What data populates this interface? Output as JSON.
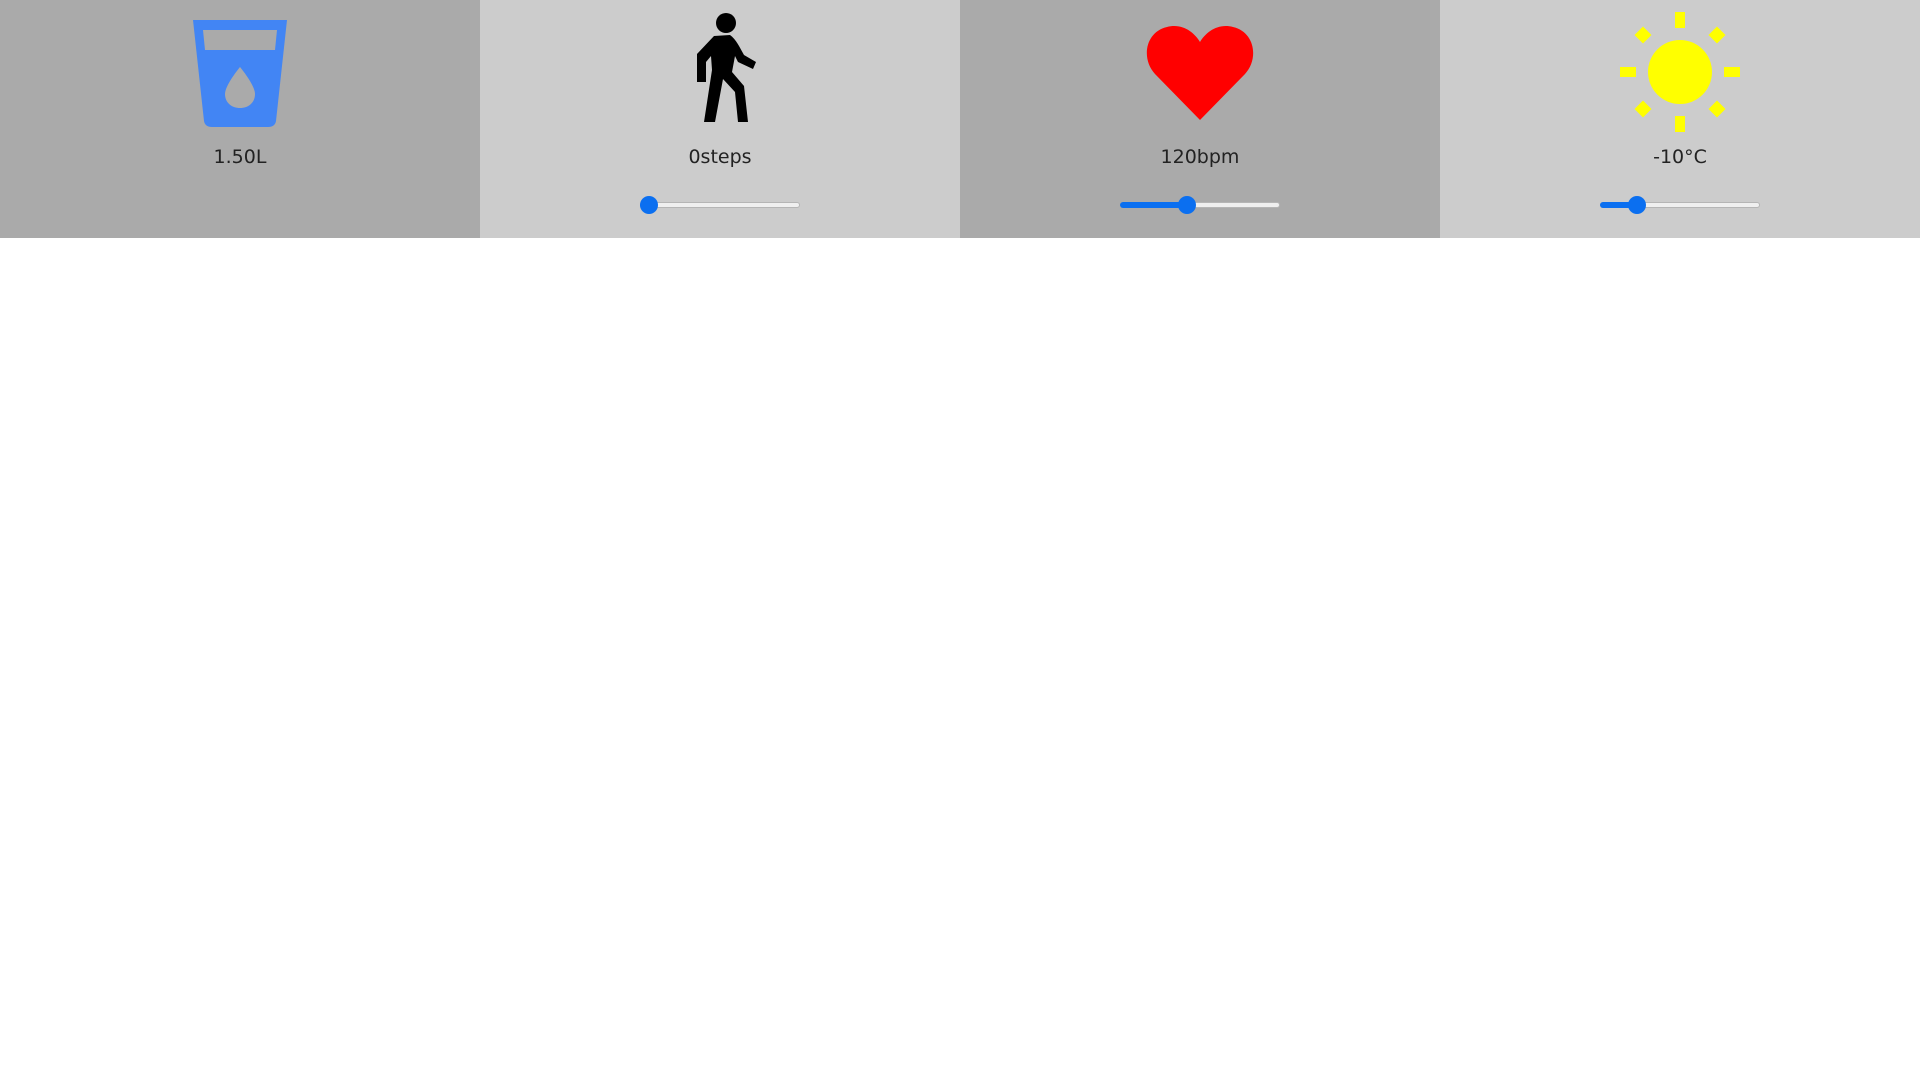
{
  "panels": [
    {
      "id": "water",
      "icon": "water-glass-icon",
      "icon_color": "#4285f4",
      "background": "#aaaaaa",
      "value": "1.50L",
      "has_slider": false
    },
    {
      "id": "steps",
      "icon": "walking-person-icon",
      "icon_color": "#000000",
      "background": "#cccccc",
      "value": "0steps",
      "has_slider": true,
      "slider_fraction": 0.0
    },
    {
      "id": "heart",
      "icon": "heart-icon",
      "icon_color": "#ff0000",
      "background": "#aaaaaa",
      "value": "120bpm",
      "has_slider": true,
      "slider_fraction": 0.41
    },
    {
      "id": "temperature",
      "icon": "sun-icon",
      "icon_color": "#ffff00",
      "background": "#cccccc",
      "value": "-10°C",
      "has_slider": true,
      "slider_fraction": 0.2
    }
  ],
  "colors": {
    "accent": "#0b6ff0",
    "text": "#222222"
  }
}
